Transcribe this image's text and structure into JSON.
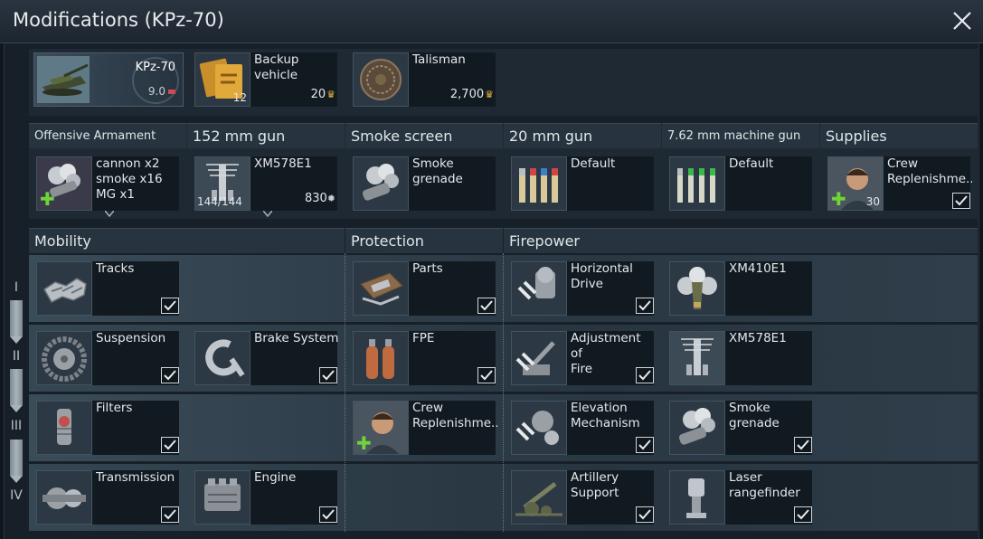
{
  "window": {
    "title": "Modifications (KPz-70)"
  },
  "vehicle": {
    "name": "KPz-70",
    "br": "9.0"
  },
  "top_slots": {
    "backup": {
      "label": "Backup\nvehicle",
      "count": "12",
      "price": "20"
    },
    "talisman": {
      "label": "Talisman",
      "price": "2,700"
    }
  },
  "armament_columns": [
    {
      "title": "Offensive Armament"
    },
    {
      "title": "152 mm gun"
    },
    {
      "title": "Smoke screen"
    },
    {
      "title": "20 mm gun"
    },
    {
      "title": "7.62 mm machine gun"
    },
    {
      "title": "Supplies"
    }
  ],
  "armament_slots": {
    "offensive": {
      "label": "cannon x2\nsmoke x16\nMG x1"
    },
    "gun152": {
      "label": "XM578E1",
      "count": "144/144",
      "price": "830"
    },
    "smoke": {
      "label": "Smoke\ngrenade"
    },
    "gun20": {
      "label": "Default"
    },
    "mg762": {
      "label": "Default"
    },
    "supplies": {
      "label": "Crew\nReplenishme...",
      "count": "30"
    }
  },
  "sections": {
    "mobility": "Mobility",
    "protection": "Protection",
    "firepower": "Firepower"
  },
  "tiers": [
    "I",
    "II",
    "III",
    "IV"
  ],
  "mods": {
    "tracks": "Tracks",
    "suspension": "Suspension",
    "brake": "Brake System",
    "filters": "Filters",
    "transmission": "Transmission",
    "engine": "Engine",
    "parts": "Parts",
    "fpe": "FPE",
    "crew": "Crew\nReplenishme...",
    "horizontal_drive": "Horizontal\nDrive",
    "xm410": "XM410E1",
    "adjustment": "Adjustment of\nFire",
    "xm578": "XM578E1",
    "elevation": "Elevation\nMechanism",
    "smoke_grenade": "Smoke\ngrenade",
    "artillery": "Artillery\nSupport",
    "laser": "Laser\nrangefinder"
  },
  "colors": {
    "eagle": "#e3b83a",
    "plus": "#6fd43a",
    "br_flag": "#d04a55"
  }
}
